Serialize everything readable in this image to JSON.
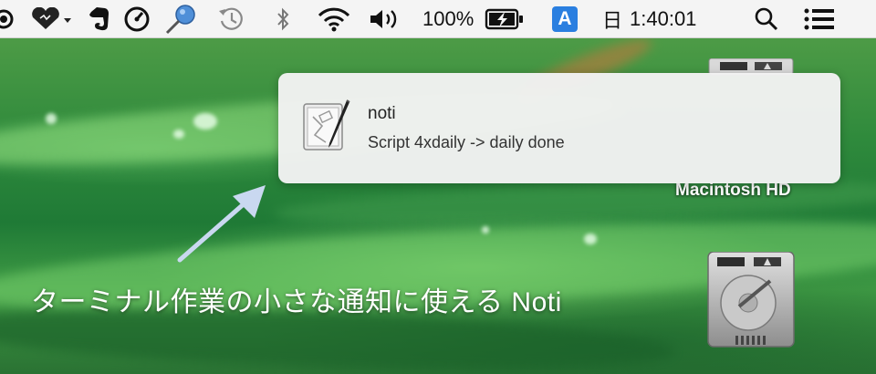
{
  "menubar": {
    "battery_percent": "100%",
    "input_method": "A",
    "day": "日",
    "time": "1:40:01",
    "icons": [
      "record-icon",
      "heart-dropdown-icon",
      "evernote-icon",
      "gauge-icon",
      "pin-icon",
      "time-machine-icon",
      "bluetooth-icon",
      "wifi-icon",
      "volume-icon",
      "battery-charging-icon",
      "input-method-icon",
      "spotlight-search-icon",
      "notification-center-icon"
    ]
  },
  "notification": {
    "title": "noti",
    "message": "Script 4xdaily -> daily done",
    "icon": "script-editor-icon"
  },
  "desktop": {
    "drive_label": "Macintosh HD",
    "caption": "ターミナル作業の小さな通知に使える Noti"
  },
  "colors": {
    "menubar_bg": "#f4f4f4",
    "notification_bg": "#f2f2f2",
    "input_method_badge": "#2a7fe0",
    "arrow": "#c9d8f0"
  }
}
